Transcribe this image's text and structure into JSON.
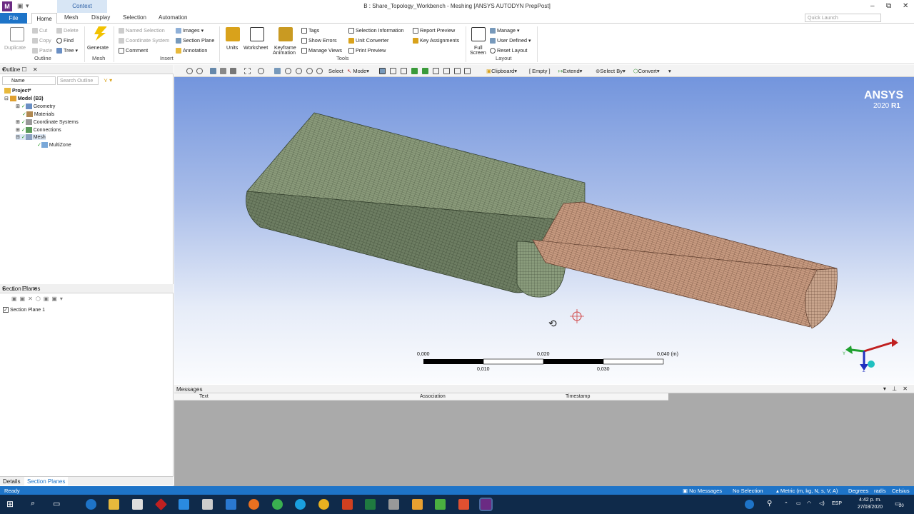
{
  "window": {
    "title": "B : Share_Topology_Workbench - Meshing [ANSYS AUTODYN PrepPost]",
    "context_tab": "Context",
    "app_icon_letter": "M",
    "quick_launch_placeholder": "Quick Launch"
  },
  "tabs": [
    "File",
    "Home",
    "Mesh",
    "Display",
    "Selection",
    "Automation"
  ],
  "ribbon": {
    "outline": {
      "duplicate": "Duplicate",
      "cut": "Cut",
      "copy": "Copy",
      "paste": "Paste",
      "delete": "Delete",
      "find": "Find",
      "tree": "Tree",
      "group": "Outline"
    },
    "mesh": {
      "generate": "Generate",
      "group": "Mesh"
    },
    "insert": {
      "named_selection": "Named Selection",
      "coordinate_system": "Coordinate System",
      "comment": "Comment",
      "images": "Images",
      "section_plane": "Section Plane",
      "annotation": "Annotation",
      "group": "Insert"
    },
    "tools": {
      "units": "Units",
      "worksheet": "Worksheet",
      "keyframe": "Keyframe",
      "animation": "Animation",
      "tags": "Tags",
      "show_errors": "Show Errors",
      "manage_views": "Manage Views",
      "selection_information": "Selection Information",
      "unit_converter": "Unit Converter",
      "print_preview": "Print Preview",
      "report_preview": "Report Preview",
      "key_assignments": "Key Assignments",
      "group": "Tools"
    },
    "layout": {
      "full": "Full",
      "screen": "Screen",
      "manage": "Manage",
      "user_defined": "User Defined",
      "reset_layout": "Reset Layout",
      "group": "Layout"
    }
  },
  "outline_panel": {
    "title": "Outline",
    "name_label": "Name",
    "search_placeholder": "Search Outline",
    "tree": [
      {
        "label": "Project*"
      },
      {
        "label": "Model (B3)"
      },
      {
        "label": "Geometry"
      },
      {
        "label": "Materials"
      },
      {
        "label": "Coordinate Systems"
      },
      {
        "label": "Connections"
      },
      {
        "label": "Mesh"
      },
      {
        "label": "MultiZone"
      }
    ]
  },
  "section_planes_panel": {
    "title": "Section Planes",
    "items": [
      "Section Plane 1"
    ]
  },
  "bottom_tabs": [
    "Details",
    "Section Planes"
  ],
  "view_toolbar": {
    "select": "Select",
    "mode": "Mode",
    "clipboard": "Clipboard",
    "empty": "[ Empty ]",
    "extend": "Extend",
    "select_by": "Select By",
    "convert": "Convert"
  },
  "viewport": {
    "brand": "ANSYS",
    "version": "2020",
    "release": "R1",
    "scale_top": [
      "0,000",
      "0,020",
      "0,040 (m)"
    ],
    "scale_bottom": [
      "0,010",
      "0,030"
    ],
    "axis_labels": [
      "X",
      "Y",
      "Z"
    ],
    "colors": {
      "green_body": "#7f9172",
      "orange_body": "#c5957b",
      "background_top": "#7395dd"
    }
  },
  "messages": {
    "title": "Messages",
    "columns": [
      "Text",
      "Association",
      "Timestamp"
    ]
  },
  "status_bar": {
    "ready": "Ready",
    "messages": "No Messages",
    "selection": "No Selection",
    "units": "Metric (m, kg, N, s, V, A)",
    "degrees": "Degrees",
    "rads": "rad/s",
    "temp": "Celsius"
  },
  "taskbar": {
    "time": "4:42 p. m.",
    "date": "27/03/2020",
    "lang": "ESP",
    "notifications": "20"
  }
}
